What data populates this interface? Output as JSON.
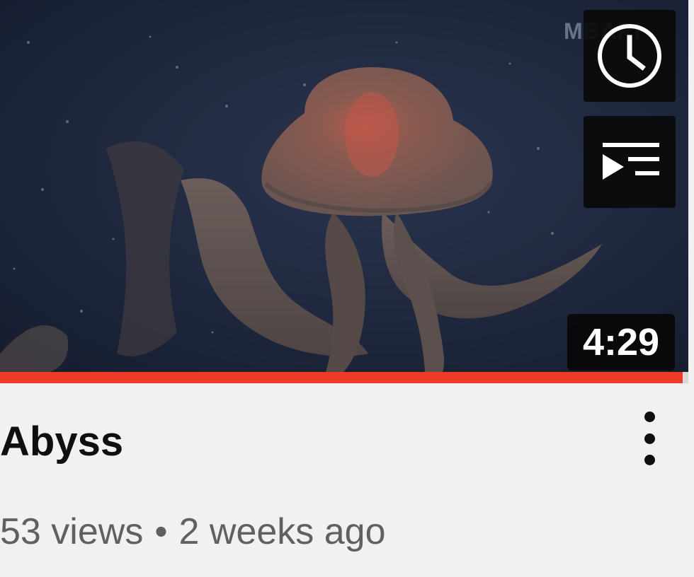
{
  "video": {
    "title": "Abyss",
    "views": "53 views",
    "separator": "•",
    "age": "2 weeks ago",
    "duration": "4:29",
    "watermark": "MBARI",
    "watch_progress": 0.992,
    "thumbnail_subject": "jellyfish"
  },
  "actions": {
    "watch_later_icon": "clock-icon",
    "add_to_queue_icon": "playlist-add-icon",
    "more_icon": "more-vertical-icon"
  },
  "colors": {
    "progress": "#ee3a26",
    "background": "#f1f1f1",
    "title": "#0f0f0f",
    "meta": "#606060"
  }
}
